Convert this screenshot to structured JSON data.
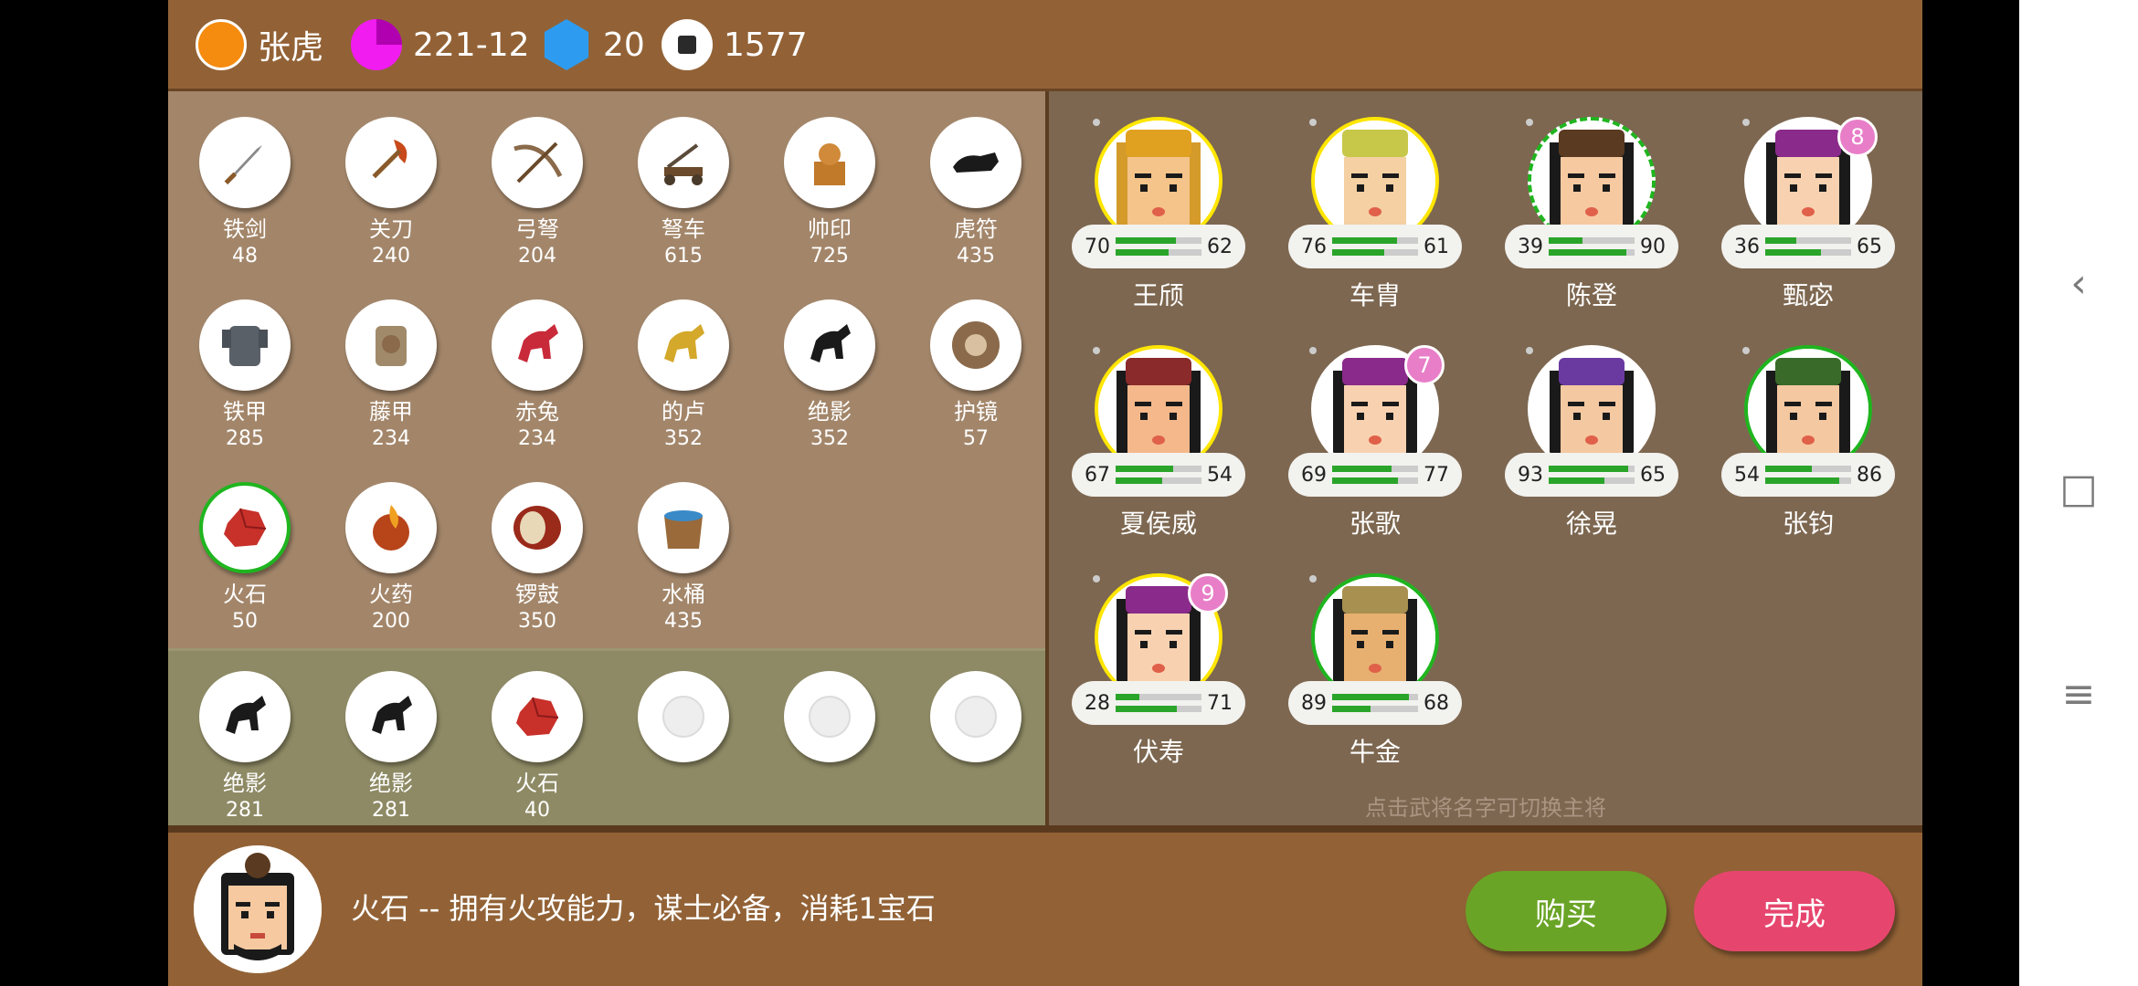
{
  "topbar": {
    "player_name": "张虎",
    "record": "221-12",
    "gems": "20",
    "coins": "1577",
    "icons": [
      "gold-circle-icon",
      "pie-chart-icon",
      "blue-hexagon-icon",
      "coin-icon"
    ]
  },
  "shop_items": [
    {
      "name": "铁剑",
      "value": "48",
      "icon": "sword-icon"
    },
    {
      "name": "关刀",
      "value": "240",
      "icon": "guandao-blade-icon"
    },
    {
      "name": "弓弩",
      "value": "204",
      "icon": "crossbow-icon"
    },
    {
      "name": "弩车",
      "value": "615",
      "icon": "ballista-icon"
    },
    {
      "name": "帅印",
      "value": "725",
      "icon": "seal-icon"
    },
    {
      "name": "虎符",
      "value": "435",
      "icon": "tiger-tally-icon"
    },
    {
      "name": "铁甲",
      "value": "285",
      "icon": "iron-armor-icon"
    },
    {
      "name": "藤甲",
      "value": "234",
      "icon": "rattan-armor-icon"
    },
    {
      "name": "赤兔",
      "value": "234",
      "icon": "red-horse-icon"
    },
    {
      "name": "的卢",
      "value": "352",
      "icon": "golden-horse-icon"
    },
    {
      "name": "绝影",
      "value": "352",
      "icon": "black-horse-icon"
    },
    {
      "name": "护镜",
      "value": "57",
      "icon": "mirror-shield-icon"
    },
    {
      "name": "火石",
      "value": "50",
      "icon": "flint-icon",
      "selected": true
    },
    {
      "name": "火药",
      "value": "200",
      "icon": "gunpowder-icon"
    },
    {
      "name": "锣鼓",
      "value": "350",
      "icon": "drum-icon"
    },
    {
      "name": "水桶",
      "value": "435",
      "icon": "water-bucket-icon"
    }
  ],
  "bag_items": [
    {
      "name": "绝影",
      "value": "281",
      "icon": "black-horse-icon"
    },
    {
      "name": "绝影",
      "value": "281",
      "icon": "black-horse-icon"
    },
    {
      "name": "火石",
      "value": "40",
      "icon": "flint-icon"
    },
    {
      "name": "",
      "value": "",
      "icon": "empty-slot-icon"
    },
    {
      "name": "",
      "value": "",
      "icon": "empty-slot-icon"
    },
    {
      "name": "",
      "value": "",
      "icon": "empty-slot-icon"
    }
  ],
  "heroes": [
    {
      "name": "王颀",
      "stat1": "70",
      "stat2": "62",
      "bar1": 0.7,
      "bar2": 0.62,
      "border": "yellow",
      "badge": "",
      "skin": "#f4c48a",
      "hair": "#d49a2a",
      "helmet": "#e0a020"
    },
    {
      "name": "车胄",
      "stat1": "76",
      "stat2": "61",
      "bar1": 0.76,
      "bar2": 0.61,
      "border": "yellow",
      "badge": "",
      "skin": "#f4d0a2",
      "hair": "#fff",
      "helmet": "#c7c74a"
    },
    {
      "name": "陈登",
      "stat1": "39",
      "stat2": "90",
      "bar1": 0.39,
      "bar2": 0.9,
      "border": "dash",
      "badge": "",
      "skin": "#f6c9a0",
      "hair": "#1a1a1a",
      "helmet": "#5a3a20"
    },
    {
      "name": "甄宓",
      "stat1": "36",
      "stat2": "65",
      "bar1": 0.36,
      "bar2": 0.65,
      "border": "white",
      "badge": "8",
      "skin": "#f8d2b0",
      "hair": "#1a1a1a",
      "helmet": "#8a2a8a"
    },
    {
      "name": "夏侯威",
      "stat1": "67",
      "stat2": "54",
      "bar1": 0.67,
      "bar2": 0.54,
      "border": "yellow",
      "badge": "",
      "skin": "#f4b88a",
      "hair": "#1a1a1a",
      "helmet": "#8a2a2a"
    },
    {
      "name": "张歌",
      "stat1": "69",
      "stat2": "77",
      "bar1": 0.69,
      "bar2": 0.77,
      "border": "white",
      "badge": "7",
      "skin": "#f8d2b0",
      "hair": "#1a1a1a",
      "helmet": "#8a2a8a"
    },
    {
      "name": "徐晃",
      "stat1": "93",
      "stat2": "65",
      "bar1": 0.93,
      "bar2": 0.65,
      "border": "white",
      "badge": "",
      "skin": "#f4c8a0",
      "hair": "#1a1a1a",
      "helmet": "#6a3aa0"
    },
    {
      "name": "张钧",
      "stat1": "54",
      "stat2": "86",
      "bar1": 0.54,
      "bar2": 0.86,
      "border": "green",
      "badge": "",
      "skin": "#f4c8a0",
      "hair": "#1a1a1a",
      "helmet": "#3a6a2a"
    },
    {
      "name": "伏寿",
      "stat1": "28",
      "stat2": "71",
      "bar1": 0.28,
      "bar2": 0.71,
      "border": "yellow",
      "badge": "9",
      "skin": "#f8d2b0",
      "hair": "#1a1a1a",
      "helmet": "#8a2a8a"
    },
    {
      "name": "牛金",
      "stat1": "89",
      "stat2": "68",
      "bar1": 0.89,
      "bar2": 0.45,
      "border": "green",
      "badge": "",
      "skin": "#e8b070",
      "hair": "#1a1a1a",
      "helmet": "#a89050"
    }
  ],
  "hint": "点击武将名字可切换主将",
  "bottom": {
    "description": "火石 -- 拥有火攻能力，谋士必备，消耗1宝石",
    "buy_label": "购买",
    "done_label": "完成"
  },
  "navbar": {
    "back": "‹",
    "home": "□",
    "menu": "≡"
  }
}
